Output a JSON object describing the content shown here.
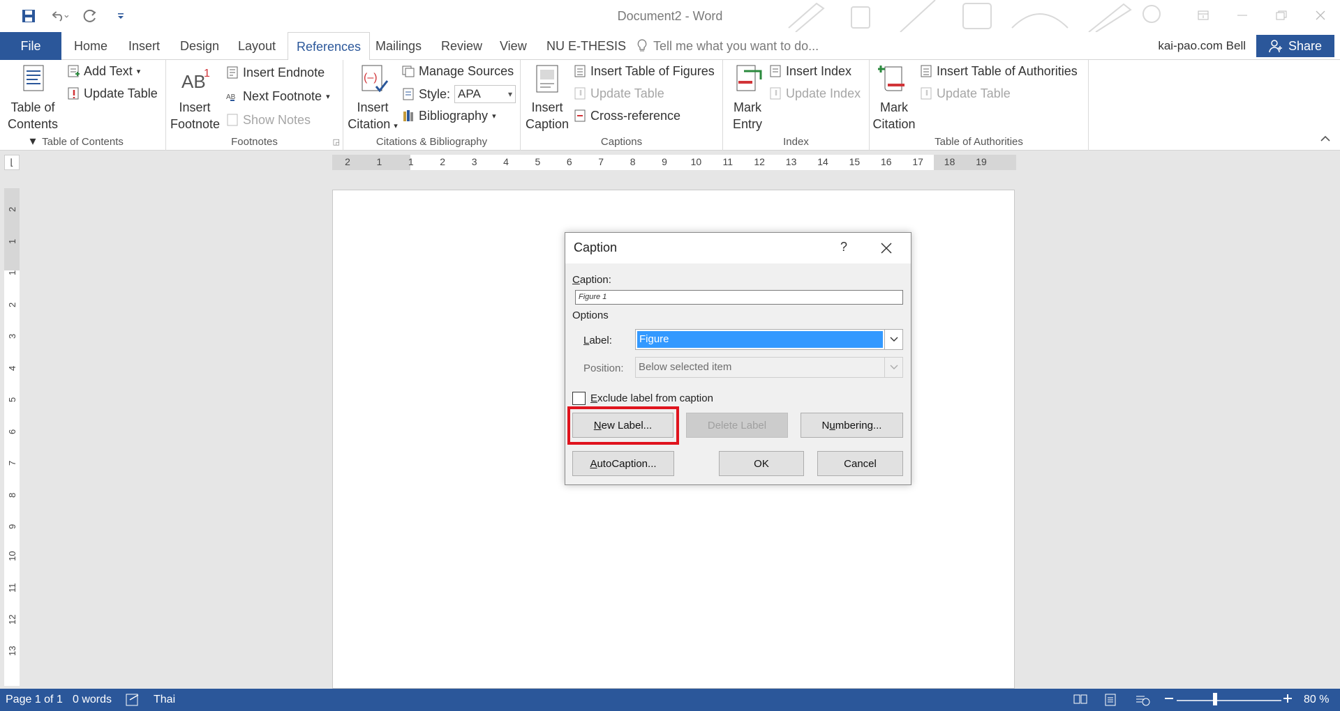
{
  "window": {
    "title": "Document2 - Word",
    "user": "kai-pao.com Bell",
    "share_label": "Share"
  },
  "tabs": [
    {
      "label": "File"
    },
    {
      "label": "Home"
    },
    {
      "label": "Insert"
    },
    {
      "label": "Design"
    },
    {
      "label": "Layout"
    },
    {
      "label": "References"
    },
    {
      "label": "Mailings"
    },
    {
      "label": "Review"
    },
    {
      "label": "View"
    },
    {
      "label": "NU E-THESIS"
    }
  ],
  "tell_me_placeholder": "Tell me what you want to do...",
  "ribbon": {
    "toc": {
      "label": "Table of Contents",
      "big_line1": "Table of",
      "big_line2": "Contents",
      "add_text": "Add Text",
      "update_table": "Update Table"
    },
    "footnotes": {
      "label": "Footnotes",
      "insert_line1": "Insert",
      "insert_line2": "Footnote",
      "insert_endnote": "Insert Endnote",
      "next_footnote": "Next Footnote",
      "show_notes": "Show Notes"
    },
    "citations": {
      "label": "Citations & Bibliography",
      "insert_line1": "Insert",
      "insert_line2": "Citation",
      "manage_sources": "Manage Sources",
      "style_label": "Style:",
      "style_value": "APA",
      "bibliography": "Bibliography"
    },
    "captions": {
      "label": "Captions",
      "insert_line1": "Insert",
      "insert_line2": "Caption",
      "insert_tof": "Insert Table of Figures",
      "update_table": "Update Table",
      "cross_reference": "Cross-reference"
    },
    "index": {
      "label": "Index",
      "mark_line1": "Mark",
      "mark_line2": "Entry",
      "insert_index": "Insert Index",
      "update_index": "Update Index"
    },
    "authorities": {
      "label": "Table of Authorities",
      "mark_line1": "Mark",
      "mark_line2": "Citation",
      "insert_toa": "Insert Table of Authorities",
      "update_table": "Update Table"
    }
  },
  "ruler": {
    "h_ticks": [
      "2",
      "1",
      "1",
      "2",
      "3",
      "4",
      "5",
      "6",
      "7",
      "8",
      "9",
      "10",
      "11",
      "12",
      "13",
      "14",
      "15",
      "16",
      "17",
      "18",
      "19"
    ],
    "v_ticks": [
      "2",
      "1",
      "1",
      "2",
      "3",
      "4",
      "5",
      "6",
      "7",
      "8",
      "9",
      "10",
      "11",
      "12",
      "13"
    ]
  },
  "dialog": {
    "title": "Caption",
    "help": "?",
    "caption_label_u": "C",
    "caption_label_rest": "aption:",
    "caption_value": "Figure 1",
    "options_label": "Options",
    "label_label_u": "L",
    "label_label_rest": "abel:",
    "label_value": "Figure",
    "position_label": "Position:",
    "position_value": "Below selected item",
    "exclude_u": "E",
    "exclude_rest": "xclude label from caption",
    "exclude_checked": false,
    "new_label_u": "N",
    "new_label_rest": "ew Label...",
    "delete_label": "Delete Label",
    "numbering_pre": "N",
    "numbering_u": "u",
    "numbering_rest": "mbering...",
    "autocaption_u": "A",
    "autocaption_rest": "utoCaption...",
    "ok": "OK",
    "cancel": "Cancel",
    "highlight_color": "#e0141e"
  },
  "status": {
    "page": "Page 1 of 1",
    "words": "0 words",
    "language": "Thai",
    "zoom": "80 %"
  },
  "colors": {
    "accent": "#2b579a",
    "selection": "#3399ff"
  }
}
